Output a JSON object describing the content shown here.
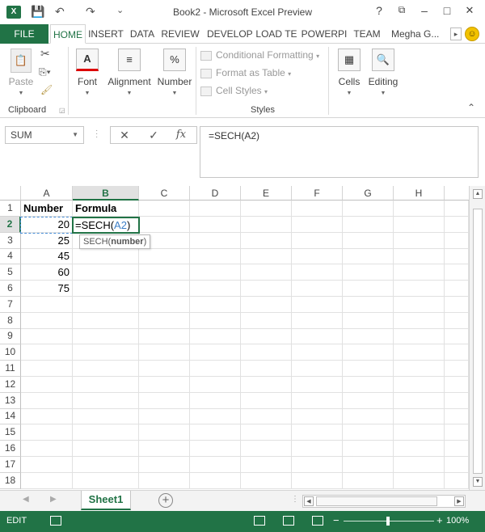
{
  "app": {
    "title": "Book2 - Microsoft Excel Preview",
    "logo_text": "X"
  },
  "title_controls": {
    "help": "?",
    "restore": "⧉",
    "minimize": "–",
    "maximize": "□",
    "close": "✕"
  },
  "qat": {
    "save": "💾",
    "undo": "↶",
    "redo": "↷",
    "customize": "⌄"
  },
  "tabs": {
    "file": "FILE",
    "items": [
      "HOME",
      "INSERT",
      "DATA",
      "REVIEW",
      "DEVELOP",
      "LOAD TE",
      "POWERPI",
      "TEAM"
    ],
    "active_index": 0,
    "user": "Megha G...",
    "scroll_right": "▸"
  },
  "ribbon": {
    "paste_label": "Paste",
    "font_label": "Font",
    "alignment_label": "Alignment",
    "number_label": "Number",
    "number_icon": "%",
    "conditional_formatting": "Conditional Formatting",
    "format_as_table": "Format as Table",
    "cell_styles": "Cell Styles",
    "cells_label": "Cells",
    "editing_label": "Editing",
    "group_clipboard": "Clipboard",
    "group_styles": "Styles",
    "collapse": "⌃"
  },
  "formula_bar": {
    "name_box": "SUM",
    "cancel": "✕",
    "enter": "✓",
    "fx": "fx",
    "formula": "=SECH(A2)"
  },
  "grid": {
    "columns": [
      "A",
      "B",
      "C",
      "D",
      "E",
      "F",
      "G",
      "H"
    ],
    "selected_column": "B",
    "selected_row": "2",
    "rows": [
      "1",
      "2",
      "3",
      "4",
      "5",
      "6",
      "7",
      "8",
      "9",
      "10",
      "11",
      "12",
      "13",
      "14",
      "15",
      "16",
      "17",
      "18"
    ],
    "cells": {
      "A1": "Number",
      "B1": "Formula",
      "A2": "20",
      "A3": "25",
      "A4": "45",
      "A5": "60",
      "A6": "75"
    },
    "active_cell": {
      "prefix": "=SECH(",
      "ref": "A2",
      "suffix": ")"
    },
    "tooltip": {
      "fn": "SECH(",
      "arg": "number",
      "close": ")"
    }
  },
  "sheets": {
    "tabs": [
      "Sheet1"
    ],
    "active": "Sheet1",
    "add": "+",
    "prev": "◀",
    "next": "▶"
  },
  "status": {
    "mode": "EDIT",
    "zoom": "100%",
    "zoom_minus": "−",
    "zoom_plus": "+"
  },
  "colors": {
    "accent": "#217346"
  }
}
